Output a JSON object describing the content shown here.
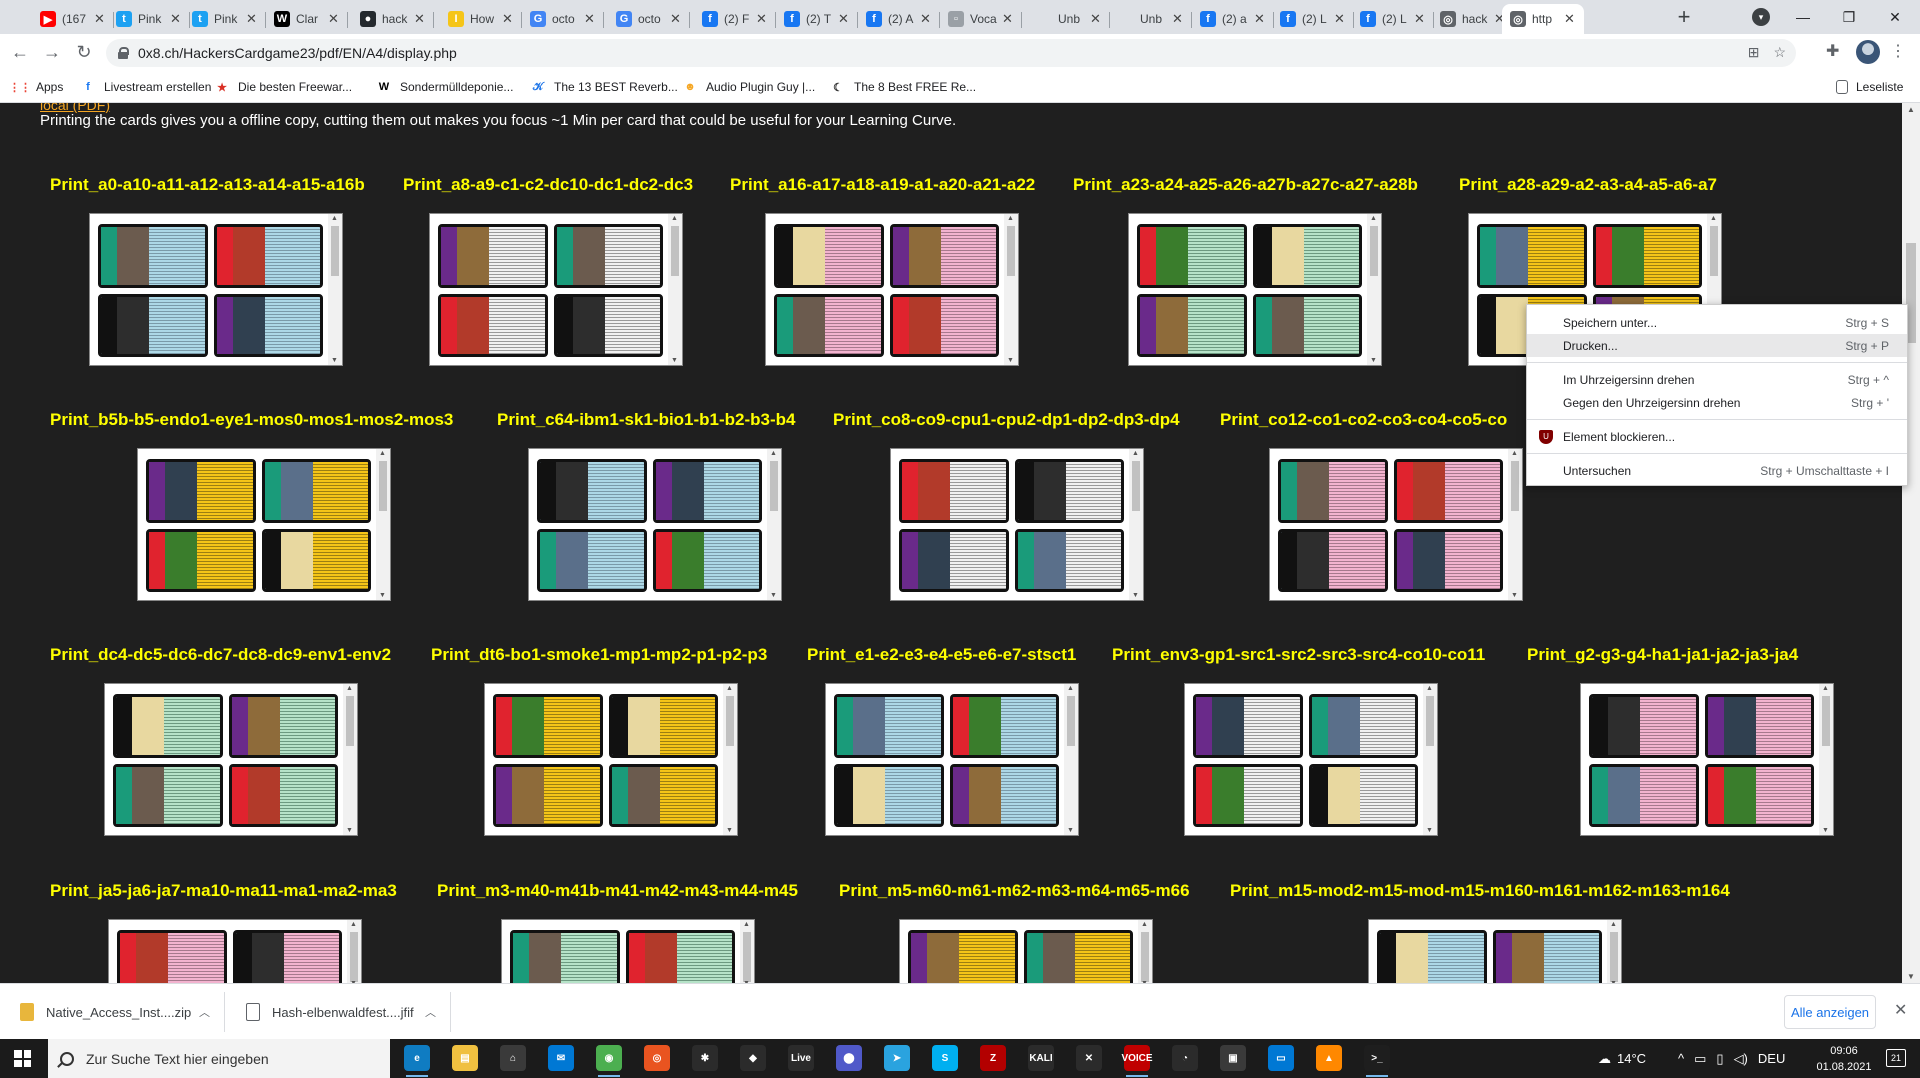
{
  "tabs": [
    {
      "title": "(167",
      "icon": "youtube-icon",
      "color": "#ff0000",
      "glyph": "▶"
    },
    {
      "title": "Pink",
      "icon": "twitter-icon",
      "color": "#1da1f2",
      "glyph": "t"
    },
    {
      "title": "Pink",
      "icon": "twitter-icon",
      "color": "#1da1f2",
      "glyph": "t"
    },
    {
      "title": "Clar",
      "icon": "wikipedia-icon",
      "color": "#000000",
      "glyph": "W"
    },
    {
      "title": "hack",
      "icon": "github-icon",
      "color": "#24292e",
      "glyph": "●"
    },
    {
      "title": "How",
      "icon": "imdb-icon",
      "color": "#f5c518",
      "glyph": "I"
    },
    {
      "title": "octo",
      "icon": "google-icon",
      "color": "#4285f4",
      "glyph": "G"
    },
    {
      "title": "octo",
      "icon": "google-icon",
      "color": "#4285f4",
      "glyph": "G"
    },
    {
      "title": "(2) F",
      "icon": "facebook-icon",
      "color": "#1877f2",
      "glyph": "f"
    },
    {
      "title": "(2) T",
      "icon": "facebook-icon",
      "color": "#1877f2",
      "glyph": "f"
    },
    {
      "title": "(2) A",
      "icon": "facebook-icon",
      "color": "#1877f2",
      "glyph": "f"
    },
    {
      "title": "Voca",
      "icon": "page-icon",
      "color": "#9aa0a6",
      "glyph": "▫"
    },
    {
      "title": "Unb",
      "icon": "blank-icon",
      "color": "#dee1e6",
      "glyph": ""
    },
    {
      "title": "Unb",
      "icon": "blank-icon",
      "color": "#dee1e6",
      "glyph": ""
    },
    {
      "title": "(2) a",
      "icon": "facebook-icon",
      "color": "#1877f2",
      "glyph": "f"
    },
    {
      "title": "(2) L",
      "icon": "facebook-icon",
      "color": "#1877f2",
      "glyph": "f"
    },
    {
      "title": "(2) L",
      "icon": "facebook-icon",
      "color": "#1877f2",
      "glyph": "f"
    },
    {
      "title": "hack",
      "icon": "globe-icon",
      "color": "#5f6368",
      "glyph": "◎"
    },
    {
      "title": "http",
      "icon": "globe-icon",
      "color": "#5f6368",
      "glyph": "◎",
      "active": true
    }
  ],
  "address": {
    "url": "0x8.ch/HackersCardgame23/pdf/EN/A4/display.php"
  },
  "bookmarks": [
    {
      "label": "Apps",
      "icon": "apps-grid-icon",
      "color": "#ea4335",
      "glyph": "⋮⋮"
    },
    {
      "label": "Livestream erstellen",
      "icon": "facebook-icon",
      "color": "#1877f2",
      "glyph": "f"
    },
    {
      "label": "Die besten Freewar...",
      "icon": "star-icon",
      "color": "#d93025",
      "glyph": "★"
    },
    {
      "label": "Sondermülldeponie...",
      "icon": "wikipedia-icon",
      "color": "#000000",
      "glyph": "W"
    },
    {
      "label": "The 13 BEST Reverb...",
      "icon": "wave-icon",
      "color": "#1a73e8",
      "glyph": "𝒦"
    },
    {
      "label": "Audio Plugin Guy |...",
      "icon": "plugin-guy-icon",
      "color": "#f5a623",
      "glyph": "☻"
    },
    {
      "label": "The 8 Best FREE Re...",
      "icon": "moon-icon",
      "color": "#333333",
      "glyph": "☾"
    }
  ],
  "reading_list": "Leseliste",
  "page": {
    "local_pdf": "local (PDF)",
    "intro": "Printing the cards gives you a offline copy, cutting them out makes you focus ~1 Min per card that could be useful for your Learning Curve."
  },
  "rows": [
    [
      "Print_a0-a10-a11-a12-a13-a14-a15-a16b",
      "Print_a8-a9-c1-c2-dc10-dc1-dc2-dc3",
      "Print_a16-a17-a18-a19-a1-a20-a21-a22",
      "Print_a23-a24-a25-a26-a27b-a27c-a27-a28b",
      "Print_a28-a29-a2-a3-a4-a5-a6-a7"
    ],
    [
      "Print_b5b-b5-endo1-eye1-mos0-mos1-mos2-mos3",
      "Print_c64-ibm1-sk1-bio1-b1-b2-b3-b4",
      "Print_co8-co9-cpu1-cpu2-dp1-dp2-dp3-dp4",
      "Print_co12-co1-co2-co3-co4-co5-co"
    ],
    [
      "Print_dc4-dc5-dc6-dc7-dc8-dc9-env1-env2",
      "Print_dt6-bo1-smoke1-mp1-mp2-p1-p2-p3",
      "Print_e1-e2-e3-e4-e5-e6-e7-stsct1",
      "Print_env3-gp1-src1-src2-src3-src4-co10-co11",
      "Print_g2-g3-g4-ha1-ja1-ja2-ja3-ja4"
    ],
    [
      "Print_ja5-ja6-ja7-ma10-ma11-ma1-ma2-ma3",
      "Print_m3-m40-m41b-m41-m42-m43-m44-m45",
      "Print_m5-m60-m61-m62-m63-m64-m65-m66",
      "Print_m15-mod2-m15-mod-m15-m160-m161-m162-m163-m164"
    ]
  ],
  "context_menu": {
    "items": [
      {
        "label": "Speichern unter...",
        "shortcut": "Strg + S"
      },
      {
        "label": "Drucken...",
        "shortcut": "Strg + P"
      },
      {
        "label": "Im Uhrzeigersinn drehen",
        "shortcut": "Strg + ^"
      },
      {
        "label": "Gegen den Uhrzeigersinn drehen",
        "shortcut": "Strg + '"
      },
      {
        "label": "Element blockieren...",
        "shortcut": ""
      },
      {
        "label": "Untersuchen",
        "shortcut": "Strg + Umschalttaste + I"
      }
    ]
  },
  "downloads": {
    "files": [
      {
        "name": "Native_Access_Inst....zip",
        "color": "#e8b63c"
      },
      {
        "name": "Hash-elbenwaldfest....jfif",
        "color": "#5f6368"
      }
    ],
    "show_all": "Alle anzeigen"
  },
  "taskbar": {
    "search_placeholder": "Zur Suche Text hier eingeben",
    "apps": [
      {
        "icon": "edge-icon",
        "color": "#0f7cc2",
        "glyph": "e"
      },
      {
        "icon": "file-explorer-icon",
        "color": "#f0c040",
        "glyph": "▤"
      },
      {
        "icon": "store-icon",
        "color": "#3a3a3a",
        "glyph": "⌂"
      },
      {
        "icon": "mail-icon",
        "color": "#0078d4",
        "glyph": "✉"
      },
      {
        "icon": "chrome-icon",
        "color": "#4caf50",
        "glyph": "◉"
      },
      {
        "icon": "ubuntu-icon",
        "color": "#e95420",
        "glyph": "◎"
      },
      {
        "icon": "ant-icon",
        "color": "#2b2b2b",
        "glyph": "✱"
      },
      {
        "icon": "inkscape-icon",
        "color": "#2b2b2b",
        "glyph": "◆"
      },
      {
        "icon": "ableton-live-icon",
        "color": "#2b2b2b",
        "glyph": "Live"
      },
      {
        "icon": "teams-icon",
        "color": "#5059c9",
        "glyph": "⬤"
      },
      {
        "icon": "telegram-icon",
        "color": "#2aa3df",
        "glyph": "➤"
      },
      {
        "icon": "skype-icon",
        "color": "#00aff0",
        "glyph": "S"
      },
      {
        "icon": "filezilla-icon",
        "color": "#b30000",
        "glyph": "Z"
      },
      {
        "icon": "kali-icon",
        "color": "#2b2b2b",
        "glyph": "KALI"
      },
      {
        "icon": "tools-icon",
        "color": "#2b2b2b",
        "glyph": "✕"
      },
      {
        "icon": "voicemeeter-icon",
        "color": "#c00000",
        "glyph": "VOICE"
      },
      {
        "icon": "chat-icon",
        "color": "#2b2b2b",
        "glyph": "◔"
      },
      {
        "icon": "archive-icon",
        "color": "#3a3a3a",
        "glyph": "▣"
      },
      {
        "icon": "remote-desktop-icon",
        "color": "#0078d4",
        "glyph": "▭"
      },
      {
        "icon": "vlc-icon",
        "color": "#ff8800",
        "glyph": "▲"
      },
      {
        "icon": "terminal-icon",
        "color": "#1e1e1e",
        "glyph": ">_"
      }
    ],
    "weather": "14°C",
    "lang": "DEU",
    "time": "09:06",
    "date": "01.08.2021",
    "notifications": "21"
  }
}
